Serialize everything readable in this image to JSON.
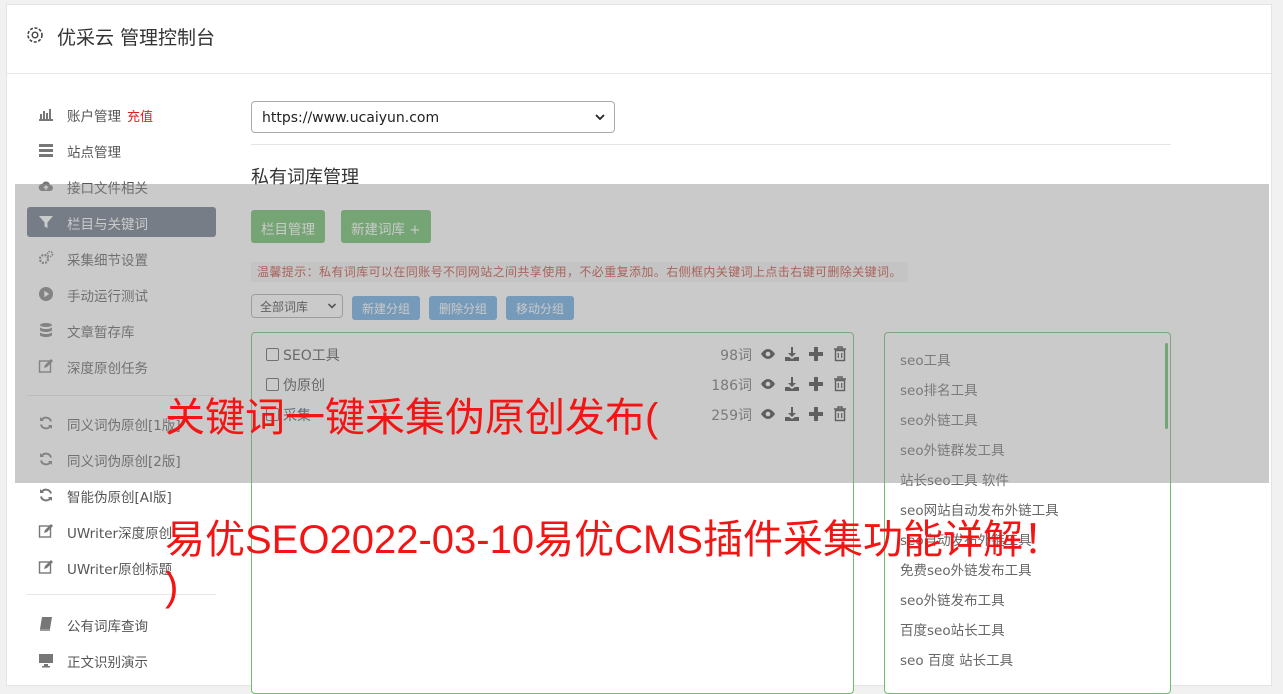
{
  "header": {
    "title": "优采云 管理控制台",
    "icon": "gear-icon"
  },
  "sidebar": {
    "items": [
      {
        "label": "账户管理",
        "badge": "充值",
        "icon": "bar-chart-icon"
      },
      {
        "label": "站点管理",
        "icon": "server-icon"
      },
      {
        "label": "接口文件相关",
        "icon": "cloud-upload-icon"
      },
      {
        "label": "栏目与关键词",
        "icon": "filter-icon",
        "active": true
      },
      {
        "label": "采集细节设置",
        "icon": "cogs-icon"
      },
      {
        "label": "手动运行测试",
        "icon": "play-circle-icon"
      },
      {
        "label": "文章暂存库",
        "icon": "database-icon"
      },
      {
        "label": "深度原创任务",
        "icon": "edit-icon"
      },
      {
        "label": "同义词伪原创[1版]",
        "icon": "refresh-icon"
      },
      {
        "label": "同义词伪原创[2版]",
        "icon": "refresh-icon"
      },
      {
        "label": "智能伪原创[AI版]",
        "icon": "refresh-icon"
      },
      {
        "label": "UWriter深度原创",
        "icon": "edit-icon"
      },
      {
        "label": "UWriter原创标题",
        "icon": "edit-icon"
      },
      {
        "label": "公有词库查询",
        "icon": "book-icon"
      },
      {
        "label": "正文识别演示",
        "icon": "monitor-icon"
      }
    ]
  },
  "main": {
    "site_select": {
      "value": "https://www.ucaiyun.com"
    },
    "section_title": "私有词库管理",
    "buttons": {
      "column_manage": "栏目管理",
      "new_library": "新建词库 +"
    },
    "tip": "温馨提示：私有词库可以在同账号不同网站之间共享使用，不必重复添加。右侧框内关键词上点击右键可删除关键词。",
    "filter": {
      "value": "全部词库"
    },
    "group_buttons": {
      "new": "新建分组",
      "delete": "删除分组",
      "move": "移动分组"
    },
    "libraries": [
      {
        "name": "SEO工具",
        "count": "98词"
      },
      {
        "name": "伪原创",
        "count": "186词"
      },
      {
        "name": "采集",
        "count": "259词"
      }
    ],
    "keywords": [
      "seo工具",
      "seo排名工具",
      "seo外链工具",
      "seo外链群发工具",
      "站长seo工具 软件",
      "seo网站自动发布外链工具",
      "seo自动发布外链工具",
      "免费seo外链发布工具",
      "seo外链发布工具",
      "百度seo站长工具",
      "seo 百度 站长工具"
    ]
  },
  "overlay": {
    "line1": "关键词一键采集伪原创发布(",
    "line2": "易优SEO2022-03-10易优CMS插件采集功能详解！",
    "line3": ")"
  },
  "colors": {
    "accent_green": "#5cb85c",
    "sidebar_active": "#5f6b7d",
    "overlay_text": "#f31414",
    "blue_button": "#5ea3e0"
  }
}
